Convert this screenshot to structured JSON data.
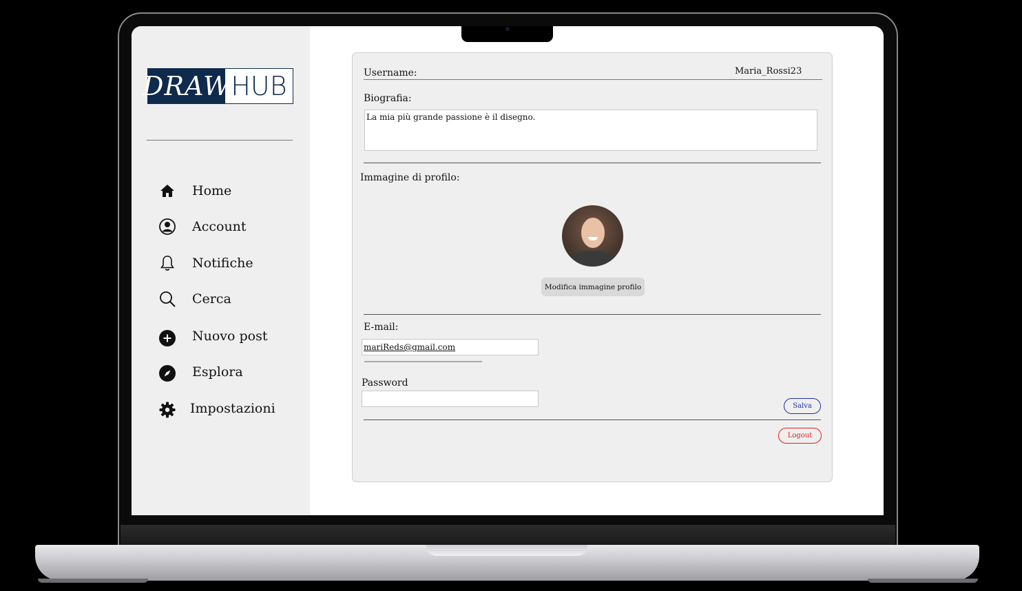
{
  "app": {
    "logo_left": "DRAW",
    "logo_right": "HUB",
    "brand_color": "#0e2a4d"
  },
  "sidebar": {
    "items": [
      {
        "label": "Home",
        "icon": "home-icon"
      },
      {
        "label": "Account",
        "icon": "account-icon"
      },
      {
        "label": "Notifiche",
        "icon": "bell-icon"
      },
      {
        "label": "Cerca",
        "icon": "search-icon"
      },
      {
        "label": "Nuovo post",
        "icon": "plus-circle-icon"
      },
      {
        "label": "Esplora",
        "icon": "compass-icon"
      },
      {
        "label": "Impostazioni",
        "icon": "gear-icon"
      }
    ]
  },
  "profile": {
    "username_label": "Username:",
    "username_value": "Maria_Rossi23",
    "bio_label": "Biografia:",
    "bio_value": "La mia più grande passione è il disegno.",
    "image_label": "Immagine di profilo:",
    "change_image_button": "Modifica immagine profilo",
    "email_label": "E-mail:",
    "email_value": "mariReds@gmail.com",
    "password_label": "Password",
    "password_value": "",
    "save_button": "Salva",
    "logout_button": "Logout",
    "save_color": "#1f2fa8",
    "logout_color": "#dd2222"
  }
}
